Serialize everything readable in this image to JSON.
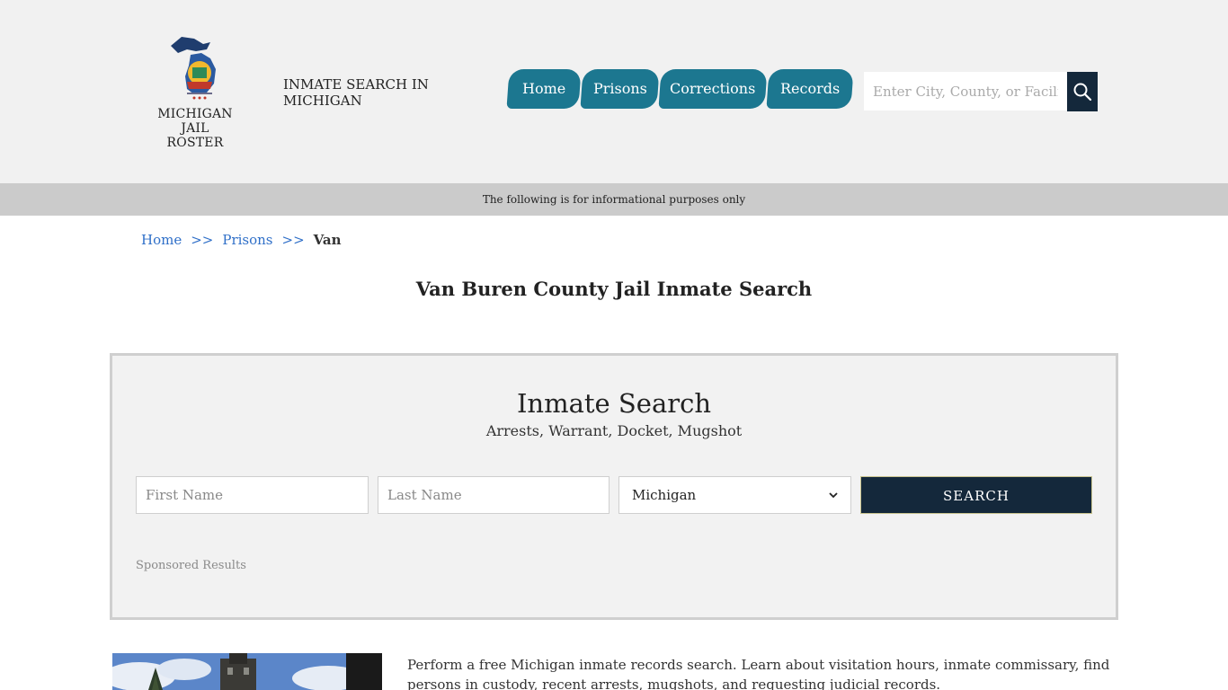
{
  "header": {
    "logo_line1": "MICHIGAN",
    "logo_line2": "JAIL ROSTER",
    "site_title": "INMATE SEARCH IN MICHIGAN",
    "nav": [
      {
        "label": "Home"
      },
      {
        "label": "Prisons"
      },
      {
        "label": "Corrections"
      },
      {
        "label": "Records"
      }
    ],
    "search_placeholder": "Enter City, County, or Facility",
    "search_icon": "search-icon"
  },
  "info_bar": "The following is for informational purposes only",
  "breadcrumb": {
    "items": [
      "Home",
      "Prisons"
    ],
    "separator": ">>",
    "current": "Van"
  },
  "page_title": "Van Buren County Jail Inmate Search",
  "panel": {
    "title": "Inmate Search",
    "subtitle": "Arrests, Warrant, Docket, Mugshot",
    "first_name_placeholder": "First Name",
    "last_name_placeholder": "Last Name",
    "state_selected": "Michigan",
    "submit_label": "SEARCH",
    "sponsored": "Sponsored Results"
  },
  "body_text": "Perform a free Michigan inmate records search. Learn about visitation hours, inmate commissary, find persons in custody, recent arrests, mugshots, and requesting judicial records.",
  "colors": {
    "nav_bg": "#1c7790",
    "dark_navy": "#14283b",
    "link_blue": "#2f6fc8",
    "header_bg": "#f1f1f1",
    "info_bar_bg": "#cbcbcb"
  }
}
